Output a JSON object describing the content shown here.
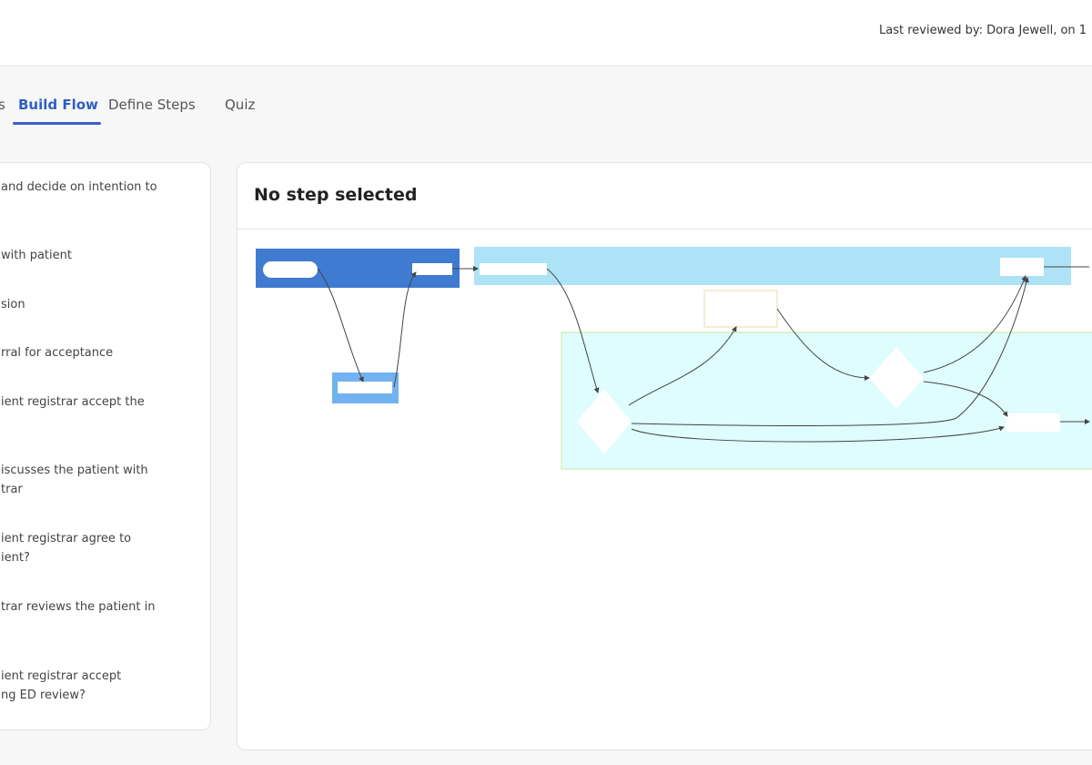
{
  "header": {
    "last_reviewed": "Last reviewed by: Dora Jewell, on 1"
  },
  "tabs": [
    {
      "label": "s",
      "active": false
    },
    {
      "label": "Build Flow",
      "active": true
    },
    {
      "label": "Define Steps",
      "active": false
    },
    {
      "label": "Quiz",
      "active": false
    }
  ],
  "steps": [
    {
      "line1": "and decide on intention to",
      "line2": ""
    },
    {
      "line1": "with patient",
      "line2": ""
    },
    {
      "line1": "sion",
      "line2": ""
    },
    {
      "line1": "rral for acceptance",
      "line2": ""
    },
    {
      "line1": "ient registrar accept the",
      "line2": ""
    },
    {
      "line1": "iscusses the patient with",
      "line2": "trar"
    },
    {
      "line1": "ient registrar agree to",
      "line2": "ient?"
    },
    {
      "line1": "trar reviews the patient in",
      "line2": ""
    },
    {
      "line1": "ient registrar accept",
      "line2": "ng ED review?"
    }
  ],
  "main": {
    "title": "No step selected"
  },
  "colors": {
    "accent": "#3b5fc9",
    "lane_dark": "#3f7bd1",
    "lane_light": "#aee3f7",
    "lane_cyan": "#dffcff",
    "box_light": "#73b2f0"
  }
}
